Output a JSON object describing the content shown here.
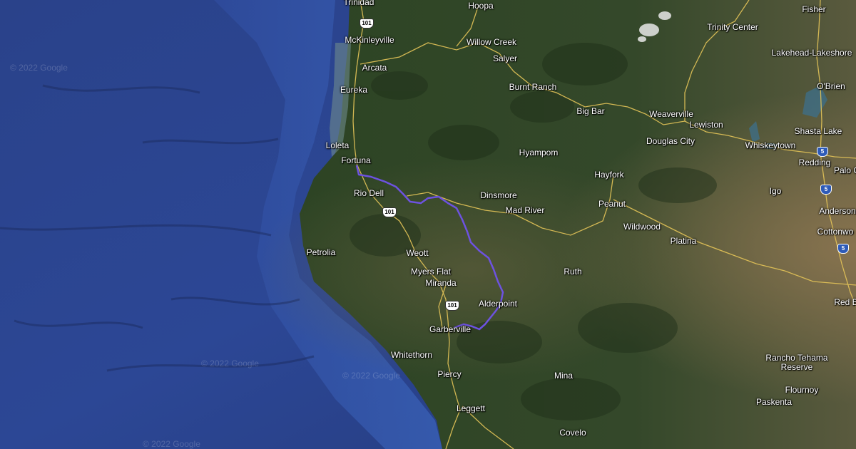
{
  "map": {
    "type": "satellite",
    "colors": {
      "ocean": "#2d4790",
      "ocean_deep": "#22366f",
      "land": "#2f4526",
      "land_dry": "#7a6a48",
      "road": "#e6c75a",
      "route": "#6b4fd8"
    }
  },
  "places": [
    {
      "name": "Trinidad"
    },
    {
      "name": "Hoopa"
    },
    {
      "name": "Fisher"
    },
    {
      "name": "McKinleyville"
    },
    {
      "name": "Willow Creek"
    },
    {
      "name": "Trinity Center"
    },
    {
      "name": "Lakehead-Lakeshore"
    },
    {
      "name": "Salyer"
    },
    {
      "name": "Arcata"
    },
    {
      "name": "O'Brien"
    },
    {
      "name": "Eureka"
    },
    {
      "name": "Burnt Ranch"
    },
    {
      "name": "Big Bar"
    },
    {
      "name": "Weaverville"
    },
    {
      "name": "Lewiston"
    },
    {
      "name": "Shasta Lake"
    },
    {
      "name": "Douglas City"
    },
    {
      "name": "Whiskeytown"
    },
    {
      "name": "Loleta"
    },
    {
      "name": "Hyampom"
    },
    {
      "name": "Redding"
    },
    {
      "name": "Fortuna"
    },
    {
      "name": "Palo C"
    },
    {
      "name": "Hayfork"
    },
    {
      "name": "Rio Dell"
    },
    {
      "name": "Dinsmore"
    },
    {
      "name": "Igo"
    },
    {
      "name": "Peanut"
    },
    {
      "name": "Mad River"
    },
    {
      "name": "Anderson"
    },
    {
      "name": "Wildwood"
    },
    {
      "name": "Cottonwo"
    },
    {
      "name": "Petrolia"
    },
    {
      "name": "Platina"
    },
    {
      "name": "Weott"
    },
    {
      "name": "Ruth"
    },
    {
      "name": "Myers Flat"
    },
    {
      "name": "Miranda"
    },
    {
      "name": "Red B"
    },
    {
      "name": "Alderpoint"
    },
    {
      "name": "Garberville"
    },
    {
      "name": "Whitethorn"
    },
    {
      "name": "Rancho Tehama Reserve"
    },
    {
      "name": "Piercy"
    },
    {
      "name": "Mina"
    },
    {
      "name": "Flournoy"
    },
    {
      "name": "Paskenta"
    },
    {
      "name": "Leggett"
    },
    {
      "name": "Covelo"
    }
  ],
  "shields": [
    {
      "label": "101",
      "kind": "us"
    },
    {
      "label": "101",
      "kind": "us"
    },
    {
      "label": "101",
      "kind": "us"
    },
    {
      "label": "5",
      "kind": "i"
    },
    {
      "label": "5",
      "kind": "i"
    },
    {
      "label": "5",
      "kind": "i"
    }
  ],
  "watermarks": [
    {
      "text": "© 2022 Google"
    },
    {
      "text": "© 2022 Google"
    },
    {
      "text": "© 2022 Google"
    },
    {
      "text": "© 2022 Google"
    }
  ]
}
